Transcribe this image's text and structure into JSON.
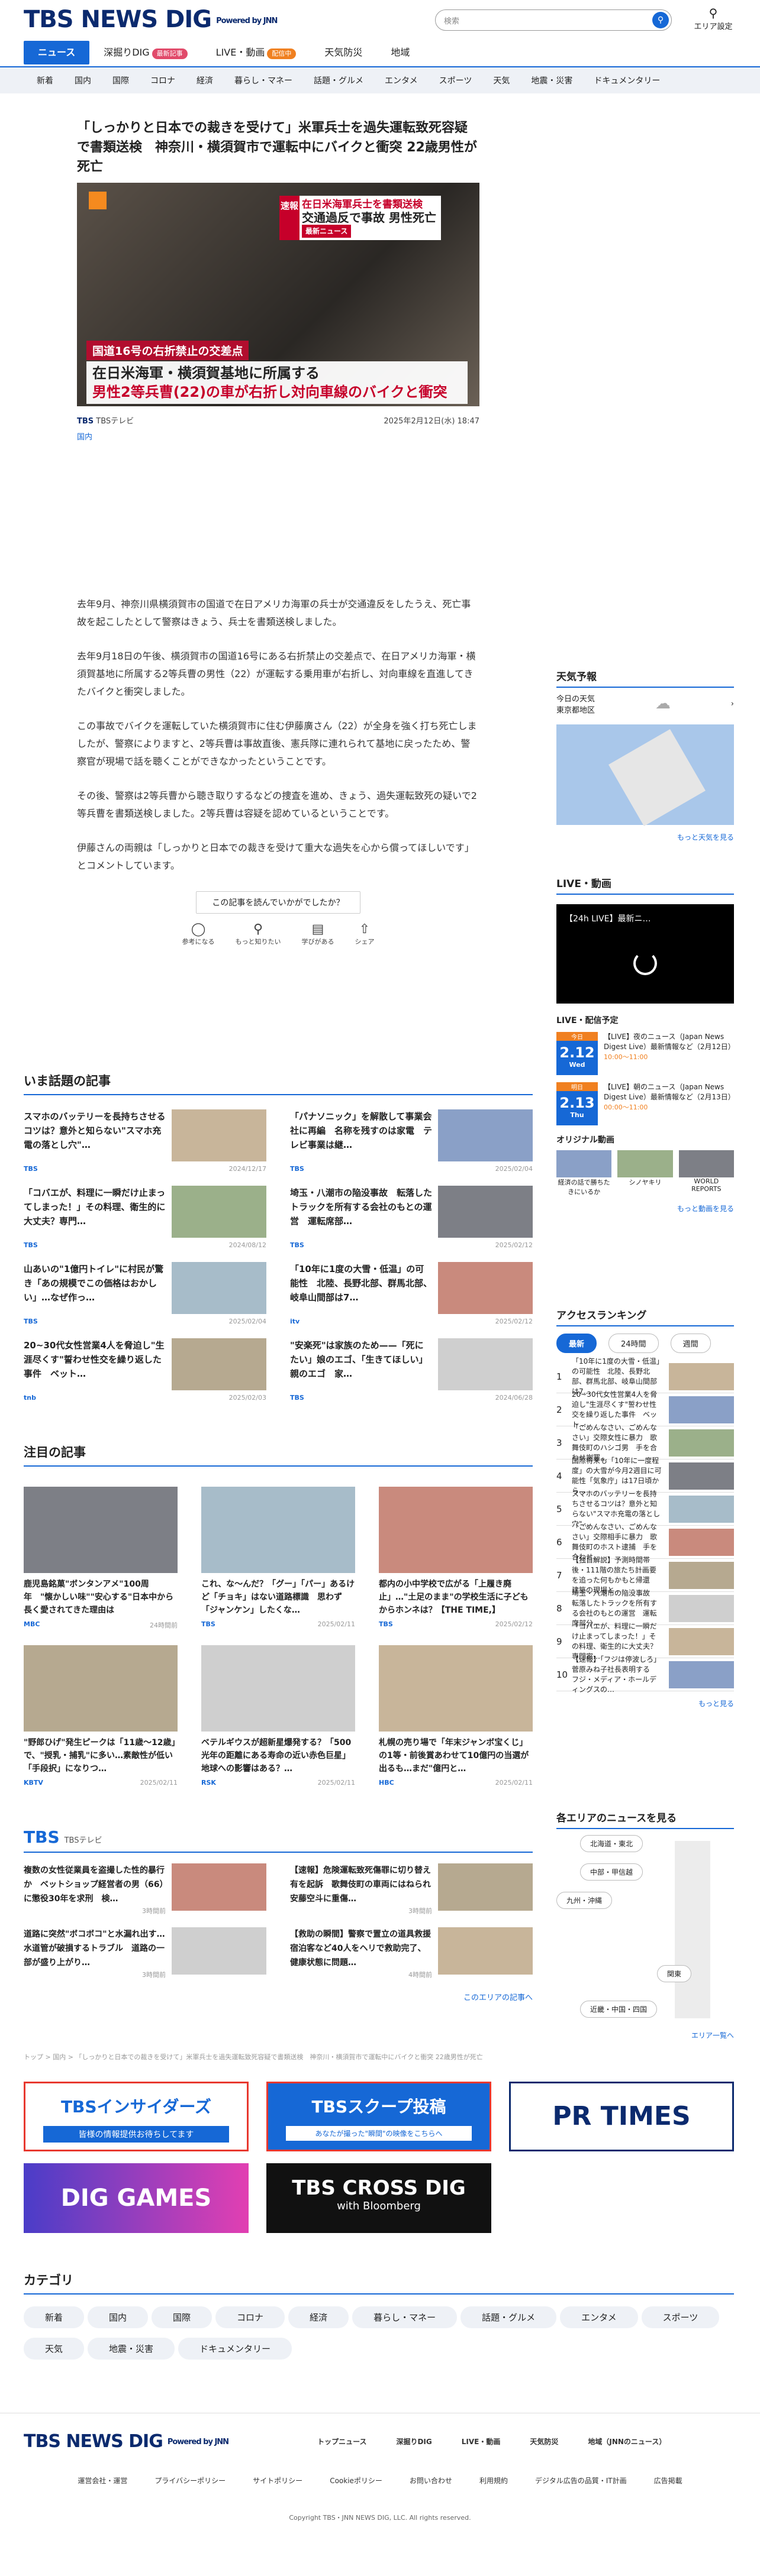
{
  "header": {
    "logo": "TBS NEWS DIG",
    "powered": "Powered by JNN",
    "search_placeholder": "検索",
    "area_label": "エリア設定"
  },
  "nav1": [
    {
      "label": "ニュース"
    },
    {
      "label": "深掘りDIG",
      "badge": "最新記事"
    },
    {
      "label": "LIVE・動画",
      "badge": "配信中"
    },
    {
      "label": "天気防災"
    },
    {
      "label": "地域"
    }
  ],
  "nav2": [
    "新着",
    "国内",
    "国際",
    "コロナ",
    "経済",
    "暮らし・マネー",
    "話題・グルメ",
    "エンタメ",
    "スポーツ",
    "天気",
    "地震・災害",
    "ドキュメンタリー"
  ],
  "article": {
    "title": "「しっかりと日本での裁きを受けて」米軍兵士を過失運転致死容疑で書類送検　神奈川・横須賀市で運転中にバイクと衝突 22歳男性が死亡",
    "hero": {
      "tl_label": "速報",
      "tl_line1": "在日米海軍兵士を書類送検",
      "tl_line2": "交通過反で事故 男性死亡",
      "tl_sub": "最新ニュース",
      "cap1": "国道16号の右折禁止の交差点",
      "cap2_1": "在日米海軍・横須賀基地に所属する",
      "cap2_2": "男性2等兵曹(22)の車が右折し対向車線のバイクと衝突"
    },
    "source": "TBSテレビ",
    "category": "国内",
    "date": "2025年2月12日(水) 18:47",
    "paragraphs": [
      "去年9月、神奈川県横須賀市の国道で在日アメリカ海軍の兵士が交通違反をしたうえ、死亡事故を起こしたとして警察はきょう、兵士を書類送検しました。",
      "去年9月18日の午後、横須賀市の国道16号にある右折禁止の交差点で、在日アメリカ海軍・横須賀基地に所属する2等兵曹の男性（22）が運転する乗用車が右折し、対向車線を直進してきたバイクと衝突しました。",
      "この事故でバイクを運転していた横須賀市に住む伊藤廣さん（22）が全身を強く打ち死亡しましたが、警察によりますと、2等兵曹は事故直後、憲兵隊に連れられて基地に戻ったため、警察官が現場で話を聴くことができなかったということです。",
      "その後、警察は2等兵曹から聴き取りするなどの捜査を進め、きょう、過失運転致死の疑いで2等兵曹を書類送検しました。2等兵曹は容疑を認めているということです。",
      "伊藤さんの両親は「しっかりと日本での裁きを受けて重大な過失を心から償ってほしいです」とコメントしています。"
    ],
    "feedback_q": "この記事を読んでいかがでしたか？",
    "feedback": [
      "参考になる",
      "もっと知りたい",
      "学びがある",
      "シェア"
    ]
  },
  "topics": {
    "title": "いま話題の記事",
    "items": [
      {
        "t": "スマホのバッテリーを長持ちさせるコツは？意外と知らない\"スマホ充電の落とし穴\"…",
        "s": "TBS",
        "d": "2024/12/17"
      },
      {
        "t": "「パナソニック」を解散して事業会社に再編　名称を残すのは家電　テレビ事業は継…",
        "s": "TBS",
        "d": "2025/02/04"
      },
      {
        "t": "「コバエが、料理に一瞬だけ止まってしまった！」その料理、衛生的に大丈夫？専門…",
        "s": "TBS",
        "d": "2024/08/12"
      },
      {
        "t": "埼玉・八潮市の陥没事故　転落したトラックを所有する会社のもとの運営　運転席部…",
        "s": "TBS",
        "d": "2025/02/12"
      },
      {
        "t": "山あいの\"1億円トイレ\"に村民が驚き「あの規模でこの価格はおかしい」…なぜ作っ…",
        "s": "TBS",
        "d": "2025/02/04"
      },
      {
        "t": "「10年に1度の大雪・低温」の可能性　北陸、長野北部、群馬北部、岐阜山間部は7…",
        "s": "itv",
        "d": "2025/02/12"
      },
      {
        "t": "20~30代女性営業4人を脅迫し\"生涯尽くす\"誓わせ性交を繰り返した事件　ベット…",
        "s": "tnb",
        "d": "2025/02/03"
      },
      {
        "t": "\"安楽死\"は家族のため——「死にたい」娘のエゴ、「生きてほしい」親のエゴ　家…",
        "s": "TBS",
        "d": "2024/06/28"
      }
    ]
  },
  "attention": {
    "title": "注目の記事",
    "items": [
      {
        "t": "鹿児島銘菓\"ボンタンアメ\"100周年　\"懐かしい味\"\"安心する\"日本中から長く愛されてきた理由は",
        "s": "MBC",
        "d": "24時間前"
      },
      {
        "t": "これ、な〜んだ？「グー」「パー」あるけど「チョキ」はない道路標識　思わず「ジャンケン」したくな…",
        "s": "TBS",
        "d": "2025/02/11"
      },
      {
        "t": "都内の小中学校で広がる「上履き廃止」…\"土足のまま\"の学校生活に子どもからホンネは？【THE TIME,】",
        "s": "TBS",
        "d": "2025/02/12"
      },
      {
        "t": "\"野郎ひげ\"発生ピークは「11歳〜12歳」で、\"授乳・捕乳\"に多い…素敵性が低い「手段択」になりつ…",
        "s": "KBTV",
        "d": "2025/02/11"
      },
      {
        "t": "ベテルギウスが超新星爆発する？「500光年の距離にある寿命の近い赤色巨星」地球への影響はある？…",
        "s": "RSK",
        "d": "2025/02/11"
      },
      {
        "t": "札幌の売り場で「年末ジャンボ宝くじ」の1等・前後賞あわせて10億円の当選が出るも…まだ\"億円と…",
        "s": "HBC",
        "d": "2025/02/11"
      }
    ]
  },
  "tbs": {
    "title": "TBS",
    "sub": "TBSテレビ",
    "items": [
      {
        "t": "複数の女性従業員を盗撮した性的暴行か　ベットショップ経営者の男（66）に懲役30年を求刑　検…",
        "d": "3時間前"
      },
      {
        "t": "【速報】危険運転致死傷罪に切り替え有を起訴　歌舞伎町の車両にはねられ安藤空斗に重傷…",
        "d": "3時間前"
      },
      {
        "t": "道路に突然\"ボコボコ\"と水漏れ出す…水道管が破損するトラブル　道路の一部が盛り上がり…",
        "d": "3時間前"
      },
      {
        "t": "【救助の瞬間】警察で置立の道具救援　宿泊客など40人をヘリで救助完了、健康状態に問題…",
        "d": "4時間前"
      }
    ],
    "more": "このエリアの記事へ"
  },
  "breadcrumb": "トップ > 国内 > 「しっかりと日本での裁きを受けて」米軍兵士を過失運転致死容疑で書類送検　神奈川・横須賀市で運転中にバイクと衝突 22歳男性が死亡",
  "banners": {
    "insider": "TBSインサイダーズ",
    "insider_sub": "皆様の情報提供お待ちしてます",
    "scoop": "TBSスクープ投稿",
    "scoop_sub": "あなたが撮った\"瞬間\"の映像をこちらへ",
    "prtimes": "PR TIMES",
    "diggames": "DIG GAMES",
    "crossdig": "TBS CROSS DIG",
    "crossdig_sub": "with Bloomberg"
  },
  "category": {
    "title": "カテゴリ",
    "items": [
      "新着",
      "国内",
      "国際",
      "コロナ",
      "経済",
      "暮らし・マネー",
      "話題・グルメ",
      "エンタメ",
      "スポーツ",
      "天気",
      "地震・災害",
      "ドキュメンタリー"
    ]
  },
  "footer": {
    "links1": [
      "トップニュース",
      "深掘りDIG",
      "LIVE・動画",
      "天気防災",
      "地域（JNNのニュース）"
    ],
    "links2": [
      "運営会社・運営",
      "プライバシーポリシー",
      "サイトポリシー",
      "Cookieポリシー",
      "お問い合わせ",
      "利用規約",
      "デジタル広告の品質・IT計画",
      "広告掲載"
    ],
    "copyright": "Copyright TBS・JNN NEWS DIG, LLC. All rights reserved."
  },
  "sidebar": {
    "weather": {
      "title": "天気予報",
      "when": "今日の天気",
      "where": "東京都地区",
      "more": "もっと天気を見る"
    },
    "live": {
      "title": "LIVE・動画",
      "player": "【24h LIVE】最新ニ…",
      "schedule": "LIVE・配信予定",
      "items": [
        {
          "tag": "今日",
          "date": "2.12",
          "wd": "Wed",
          "t": "【LIVE】夜のニュース（Japan News Digest Live）最新情報など（2月12日）",
          "time": "10:00〜11:00"
        },
        {
          "tag": "明日",
          "date": "2.13",
          "wd": "Thu",
          "t": "【LIVE】朝のニュース（Japan News Digest Live）最新情報など（2月13日）",
          "time": "00:00〜11:00"
        }
      ],
      "original": "オリジナル動画",
      "videos": [
        "経済の話で勝ちたきにいるか",
        "シノヤキリ",
        "WORLD REPORTS"
      ],
      "more": "もっと動画を見る"
    },
    "ranking": {
      "title": "アクセスランキング",
      "tabs": [
        "最新",
        "24時間",
        "週間"
      ],
      "items": [
        "「10年に1度の大雪・低温」の可能性　北陸、長野北部、群馬北部、岐阜山間部は7…",
        "20~30代女性営業4人を脅迫し\"生涯尽くす\"誓わせ性交を繰り返した事件　ベット…",
        "「ごめんなさい、ごめんなさい」交際女性に暴力　歌舞伎町のハシゴ男　手を合わせ謝罪…",
        "国際将来も「10年に一度程度」の大雪が今月2週目に可能性「気象庁」は17日頃から…",
        "スマホのバッテリーを長持ちさせるコツは？意外と知らない\"スマホ充電の落とし穴\"…",
        "「ごめんなさい、ごめんなさい」交際相手に暴力　歌舞伎町のホスト逮捕　手を合わせ…",
        "【独自解説】予測時間帯後・111階の旅たち計画要を追った何もかもと帰還　建築の現場と…",
        "埼玉・八潮市の陥没事故　転落したトラックを所有する会社のもとの運営　運転席部分…",
        "「コバエが、料理に一瞬だけ止まってしまった！」その料理、衛生的に大丈夫？専門家…",
        "【速報】「フジは停波しろ」菅原みね子社長表明する　フジ・メディア・ホールディングスの…"
      ],
      "more": "もっと見る"
    },
    "areas": {
      "title": "各エリアのニュースを見る",
      "items": [
        "北海道・東北",
        "中部・甲信越",
        "九州・沖縄",
        "関東",
        "近畿・中国・四国"
      ],
      "more": "エリア一覧へ"
    }
  }
}
